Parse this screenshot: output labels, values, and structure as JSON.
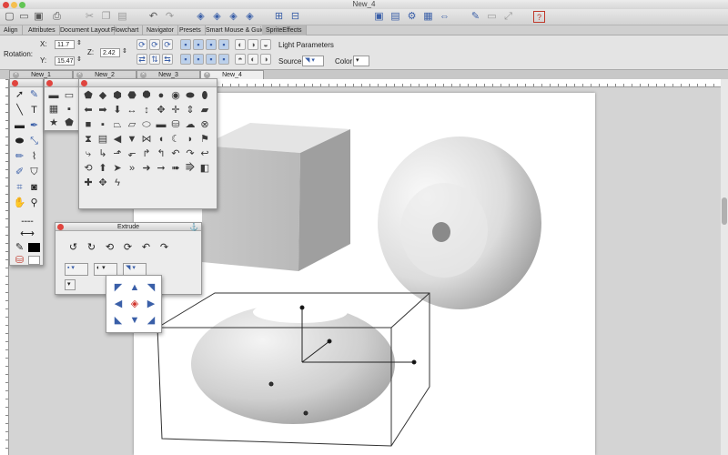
{
  "window": {
    "title": "New_4"
  },
  "menu_tabs": [
    {
      "label": "Align"
    },
    {
      "label": "Attributes"
    },
    {
      "label": "Document Layout"
    },
    {
      "label": "Flowchart"
    },
    {
      "label": "Navigator"
    },
    {
      "label": "Presets"
    },
    {
      "label": "Smart Mouse & Guides"
    },
    {
      "label": "SpriteEffects"
    }
  ],
  "rotation": {
    "label": "Rotation:",
    "x_label": "X:",
    "x_value": "11.7",
    "y_label": "Y:",
    "y_value": "15.47",
    "z_label": "Z:",
    "z_value": "2.42"
  },
  "light": {
    "title": "Light Parameters",
    "source_label": "Source",
    "color_label": "Color"
  },
  "doc_tabs": [
    {
      "label": "New_1"
    },
    {
      "label": "New_2"
    },
    {
      "label": "New_3"
    },
    {
      "label": "New_4"
    }
  ],
  "extrude": {
    "title": "Extrude"
  },
  "colors": {
    "accent": "#3a5fa8",
    "close": "#e0443e",
    "minimize": "#f5bf4f",
    "zoom": "#62c554"
  }
}
